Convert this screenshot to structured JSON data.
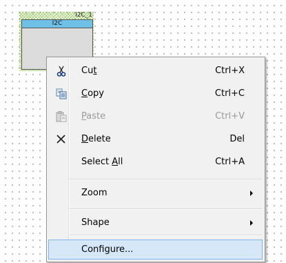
{
  "component": {
    "instance_name": "I2C_1",
    "type_label": "I2C"
  },
  "context_menu": {
    "items": [
      {
        "id": "cut",
        "label_pre": "Cu",
        "label_mn": "t",
        "label_post": "",
        "shortcut": "Ctrl+X",
        "icon": "scissors-icon",
        "disabled": false
      },
      {
        "id": "copy",
        "label_pre": "",
        "label_mn": "C",
        "label_post": "opy",
        "shortcut": "Ctrl+C",
        "icon": "copy-icon",
        "disabled": false
      },
      {
        "id": "paste",
        "label_pre": "",
        "label_mn": "P",
        "label_post": "aste",
        "shortcut": "Ctrl+V",
        "icon": "paste-icon",
        "disabled": true
      },
      {
        "id": "delete",
        "label_pre": "",
        "label_mn": "D",
        "label_post": "elete",
        "shortcut": "Del",
        "icon": "delete-x-icon",
        "disabled": false
      },
      {
        "id": "select-all",
        "label_pre": "Select ",
        "label_mn": "A",
        "label_post": "ll",
        "shortcut": "Ctrl+A",
        "icon": "",
        "disabled": false
      },
      {
        "id": "zoom",
        "label_pre": "Zoom",
        "label_mn": "",
        "label_post": "",
        "shortcut": "",
        "submenu": true,
        "disabled": false
      },
      {
        "id": "shape",
        "label_pre": "Shape",
        "label_mn": "",
        "label_post": "",
        "shortcut": "",
        "submenu": true,
        "disabled": false
      },
      {
        "id": "configure",
        "label_pre": "Confi",
        "label_mn": "g",
        "label_post": "ure...",
        "shortcut": "",
        "highlighted": true,
        "disabled": false
      }
    ]
  }
}
